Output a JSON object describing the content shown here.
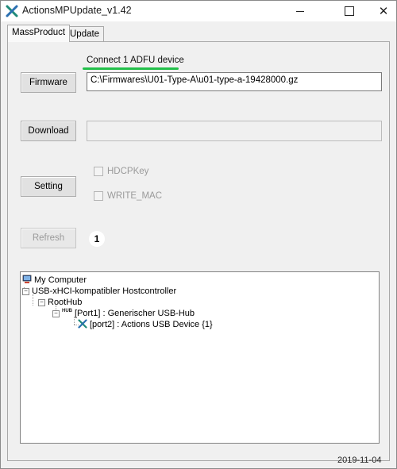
{
  "window": {
    "title": "ActionsMPUpdate_v1.42",
    "controls": {
      "minimize": "minimize-icon",
      "maximize": "maximize-icon",
      "close": "✕"
    }
  },
  "tabs": [
    {
      "label": "MassProduct",
      "active": true
    },
    {
      "label": "Update",
      "active": false
    }
  ],
  "status": {
    "text": "Connect 1 ADFU device",
    "underline_color": "#23c04a"
  },
  "firmware": {
    "button": "Firmware",
    "path": "C:\\Firmwares\\U01-Type-A\\u01-type-a-19428000.gz"
  },
  "download": {
    "button": "Download",
    "value": ""
  },
  "setting": {
    "button": "Setting",
    "options": [
      {
        "label": "HDCPKey",
        "checked": false,
        "enabled": false
      },
      {
        "label": "WRITE_MAC",
        "checked": false,
        "enabled": false
      }
    ]
  },
  "refresh": {
    "button": "Refresh",
    "enabled": false
  },
  "marker": "1",
  "tree": {
    "root": "My Computer",
    "controller": "USB-xHCI-kompatibler Hostcontroller",
    "roothub": "RootHub",
    "hub_icon_text": "HUB",
    "hub": "[Port1] : Generischer USB-Hub",
    "device": "[port2] : Actions USB Device {1}"
  },
  "footer": {
    "date": "2019-11-04"
  },
  "colors": {
    "accent": "#1f7a6e",
    "status_underline": "#23c04a"
  }
}
